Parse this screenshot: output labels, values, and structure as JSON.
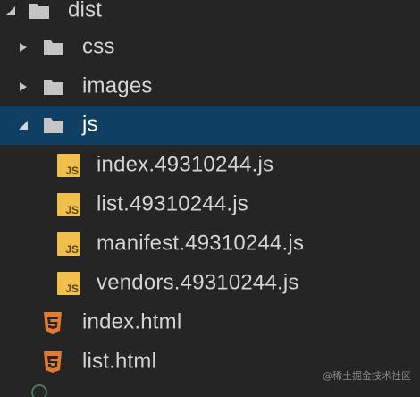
{
  "explorer": {
    "items": [
      {
        "label": "dist",
        "icon": "folder-icon",
        "expanded": true
      },
      {
        "label": "css",
        "icon": "folder-icon",
        "expanded": false
      },
      {
        "label": "images",
        "icon": "folder-icon",
        "expanded": false
      },
      {
        "label": "js",
        "icon": "folder-icon",
        "expanded": true,
        "selected": true
      },
      {
        "label": "index.49310244.js",
        "icon": "js-file-icon",
        "badge": "JS"
      },
      {
        "label": "list.49310244.js",
        "icon": "js-file-icon",
        "badge": "JS"
      },
      {
        "label": "manifest.49310244.js",
        "icon": "js-file-icon",
        "badge": "JS"
      },
      {
        "label": "vendors.49310244.js",
        "icon": "js-file-icon",
        "badge": "JS"
      },
      {
        "label": "index.html",
        "icon": "html5-file-icon"
      },
      {
        "label": "list.html",
        "icon": "html5-file-icon"
      }
    ]
  },
  "watermark": "@稀土掘金技术社区",
  "colors": {
    "background": "#252526",
    "selected_row": "#0f3f63",
    "folder": "#c5c5c5",
    "js_badge": "#f1bf4b",
    "html5": "#e37933",
    "text": "#d4d4d4"
  }
}
